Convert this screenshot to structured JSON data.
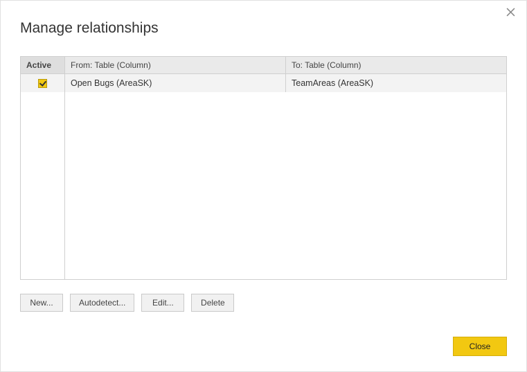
{
  "dialog": {
    "title": "Manage relationships"
  },
  "table": {
    "headers": {
      "active": "Active",
      "from": "From: Table (Column)",
      "to": "To: Table (Column)"
    },
    "rows": [
      {
        "active": true,
        "from": "Open Bugs (AreaSK)",
        "to": "TeamAreas (AreaSK)"
      }
    ]
  },
  "buttons": {
    "new": "New...",
    "autodetect": "Autodetect...",
    "edit": "Edit...",
    "delete": "Delete",
    "close": "Close"
  }
}
